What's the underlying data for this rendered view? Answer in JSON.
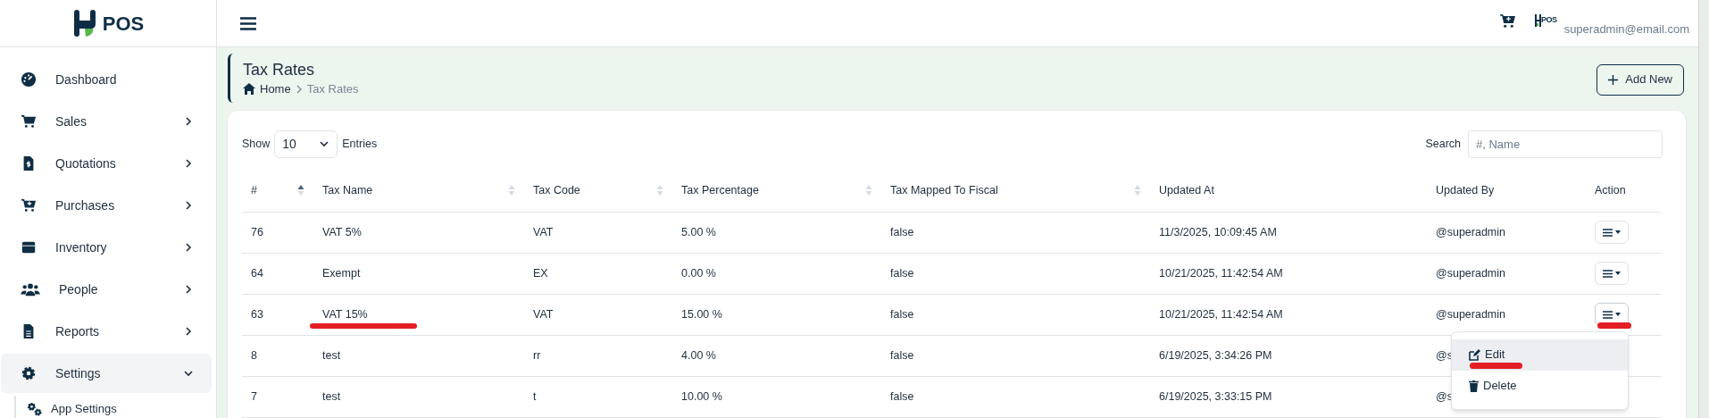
{
  "brand": {
    "text": "POS"
  },
  "sidebar": {
    "items": [
      {
        "label": "Dashboard",
        "kind": "dashboard",
        "has_children": false,
        "expanded": false
      },
      {
        "label": "Sales",
        "kind": "sales",
        "has_children": true,
        "expanded": false
      },
      {
        "label": "Quotations",
        "kind": "quotations",
        "has_children": true,
        "expanded": false
      },
      {
        "label": "Purchases",
        "kind": "purchases",
        "has_children": true,
        "expanded": false
      },
      {
        "label": "Inventory",
        "kind": "inventory",
        "has_children": true,
        "expanded": false
      },
      {
        "label": "People",
        "kind": "people",
        "has_children": true,
        "expanded": false
      },
      {
        "label": "Reports",
        "kind": "reports",
        "has_children": true,
        "expanded": false
      },
      {
        "label": "Settings",
        "kind": "settings",
        "has_children": true,
        "expanded": true,
        "children": [
          {
            "label": "App Settings",
            "kind": "app_settings"
          }
        ]
      }
    ]
  },
  "topbar": {
    "logo_text": "POS",
    "user_email": "superadmin@email.com"
  },
  "page": {
    "title": "Tax Rates",
    "breadcrumb": [
      {
        "label": "Home",
        "current": false
      },
      {
        "label": "Tax Rates",
        "current": true
      }
    ],
    "add_button": "Add New"
  },
  "table_controls": {
    "show_label": "Show",
    "page_size": "10",
    "entries_label": "Entries",
    "search_label": "Search",
    "search_placeholder": "#, Name"
  },
  "table": {
    "columns": [
      {
        "label": "#",
        "sortable": true,
        "sorted": true
      },
      {
        "label": "Tax Name",
        "sortable": true,
        "sorted": false
      },
      {
        "label": "Tax Code",
        "sortable": true,
        "sorted": false
      },
      {
        "label": "Tax Percentage",
        "sortable": true,
        "sorted": false
      },
      {
        "label": "Tax Mapped To Fiscal",
        "sortable": true,
        "sorted": false
      },
      {
        "label": "Updated At",
        "sortable": false,
        "sorted": false
      },
      {
        "label": "Updated By",
        "sortable": false,
        "sorted": false
      },
      {
        "label": "Action",
        "sortable": false,
        "sorted": false
      }
    ],
    "rows": [
      {
        "cells": [
          "76",
          "VAT 5%",
          "VAT",
          "5.00 %",
          "false",
          "11/3/2025, 10:09:45 AM",
          "@superadmin"
        ],
        "name_marked": false,
        "action_marked": false,
        "menu_open": false
      },
      {
        "cells": [
          "64",
          "Exempt",
          "EX",
          "0.00 %",
          "false",
          "10/21/2025, 11:42:54 AM",
          "@superadmin"
        ],
        "name_marked": false,
        "action_marked": false,
        "menu_open": false
      },
      {
        "cells": [
          "63",
          "VAT 15%",
          "VAT",
          "15.00 %",
          "false",
          "10/21/2025, 11:42:54 AM",
          "@superadmin"
        ],
        "name_marked": true,
        "action_marked": true,
        "menu_open": true
      },
      {
        "cells": [
          "8",
          "test",
          "rr",
          "4.00 %",
          "false",
          "6/19/2025, 3:34:26 PM",
          "@s"
        ],
        "name_marked": false
      },
      {
        "cells": [
          "7",
          "test",
          "t",
          "10.00 %",
          "false",
          "6/19/2025, 3:33:15 PM",
          "@s"
        ],
        "name_marked": false
      }
    ]
  },
  "action_menu": {
    "items": [
      {
        "label": "Edit",
        "kind": "edit",
        "hovered": true,
        "marked": true
      },
      {
        "label": "Delete",
        "kind": "delete",
        "hovered": false,
        "marked": false
      }
    ]
  }
}
